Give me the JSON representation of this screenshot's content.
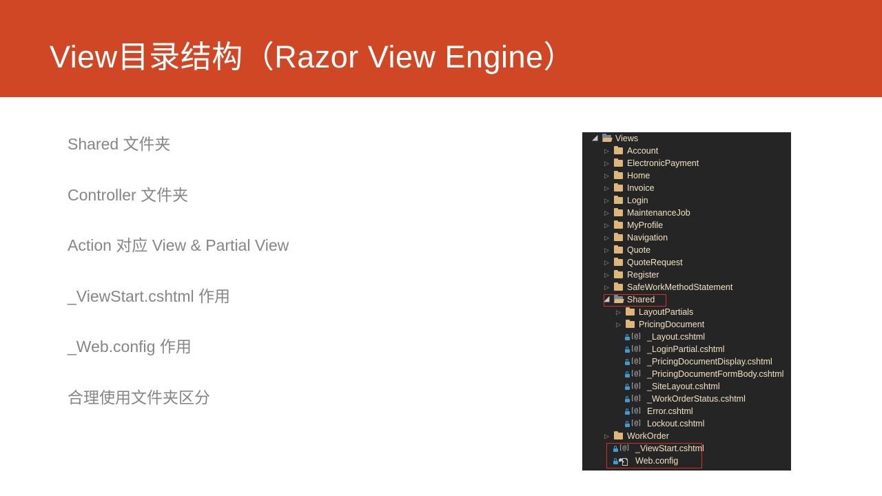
{
  "slide": {
    "title": "View目录结构（Razor View Engine）",
    "title_band_color": "#cf4725",
    "bullets": [
      "Shared 文件夹",
      "Controller 文件夹",
      "Action 对应 View & Partial View",
      "_ViewStart.cshtml 作用",
      "_Web.config 作用",
      "合理使用文件夹区分"
    ]
  },
  "solution_explorer": {
    "background_color": "#252526",
    "text_color": "#f0e2c0",
    "highlight_color": "#d32f2f",
    "nodes": [
      {
        "label": "Views",
        "type": "folder-open",
        "indent": 0,
        "expander": "expanded",
        "icon": "folder-open-icon"
      },
      {
        "label": "Account",
        "type": "folder",
        "indent": 1,
        "expander": "collapsed",
        "icon": "folder-icon"
      },
      {
        "label": "ElectronicPayment",
        "type": "folder",
        "indent": 1,
        "expander": "collapsed",
        "icon": "folder-icon"
      },
      {
        "label": "Home",
        "type": "folder",
        "indent": 1,
        "expander": "collapsed",
        "icon": "folder-icon"
      },
      {
        "label": "Invoice",
        "type": "folder",
        "indent": 1,
        "expander": "collapsed",
        "icon": "folder-icon"
      },
      {
        "label": "Login",
        "type": "folder",
        "indent": 1,
        "expander": "collapsed",
        "icon": "folder-icon"
      },
      {
        "label": "MaintenanceJob",
        "type": "folder",
        "indent": 1,
        "expander": "collapsed",
        "icon": "folder-icon"
      },
      {
        "label": "MyProfile",
        "type": "folder",
        "indent": 1,
        "expander": "collapsed",
        "icon": "folder-icon"
      },
      {
        "label": "Navigation",
        "type": "folder",
        "indent": 1,
        "expander": "collapsed",
        "icon": "folder-icon"
      },
      {
        "label": "Quote",
        "type": "folder",
        "indent": 1,
        "expander": "collapsed",
        "icon": "folder-icon"
      },
      {
        "label": "QuoteRequest",
        "type": "folder",
        "indent": 1,
        "expander": "collapsed",
        "icon": "folder-icon"
      },
      {
        "label": "Register",
        "type": "folder",
        "indent": 1,
        "expander": "collapsed",
        "icon": "folder-icon"
      },
      {
        "label": "SafeWorkMethodStatement",
        "type": "folder",
        "indent": 1,
        "expander": "collapsed",
        "icon": "folder-icon"
      },
      {
        "label": "Shared",
        "type": "folder-open",
        "indent": 1,
        "expander": "expanded",
        "icon": "folder-open-icon",
        "highlighted": true
      },
      {
        "label": "LayoutPartials",
        "type": "folder",
        "indent": 2,
        "expander": "collapsed",
        "icon": "folder-icon"
      },
      {
        "label": "PricingDocument",
        "type": "folder",
        "indent": 2,
        "expander": "collapsed",
        "icon": "folder-icon"
      },
      {
        "label": "_Layout.cshtml",
        "type": "razor-file",
        "indent": 2,
        "expander": "none",
        "icon": "razor-view-icon"
      },
      {
        "label": "_LoginPartial.cshtml",
        "type": "razor-file",
        "indent": 2,
        "expander": "none",
        "icon": "razor-view-icon"
      },
      {
        "label": "_PricingDocumentDisplay.cshtml",
        "type": "razor-file",
        "indent": 2,
        "expander": "none",
        "icon": "razor-view-icon"
      },
      {
        "label": "_PricingDocumentFormBody.cshtml",
        "type": "razor-file",
        "indent": 2,
        "expander": "none",
        "icon": "razor-view-icon"
      },
      {
        "label": "_SiteLayout.cshtml",
        "type": "razor-file",
        "indent": 2,
        "expander": "none",
        "icon": "razor-view-icon"
      },
      {
        "label": "_WorkOrderStatus.cshtml",
        "type": "razor-file",
        "indent": 2,
        "expander": "none",
        "icon": "razor-view-icon"
      },
      {
        "label": "Error.cshtml",
        "type": "razor-file",
        "indent": 2,
        "expander": "none",
        "icon": "razor-view-icon"
      },
      {
        "label": "Lockout.cshtml",
        "type": "razor-file",
        "indent": 2,
        "expander": "none",
        "icon": "razor-view-icon"
      },
      {
        "label": "WorkOrder",
        "type": "folder",
        "indent": 1,
        "expander": "collapsed",
        "icon": "folder-icon"
      },
      {
        "label": "_ViewStart.cshtml",
        "type": "razor-file",
        "indent": 1,
        "expander": "none",
        "icon": "razor-view-icon",
        "highlighted": true
      },
      {
        "label": "Web.config",
        "type": "config-file",
        "indent": 1,
        "expander": "none",
        "icon": "config-file-icon",
        "highlighted": true
      }
    ]
  }
}
